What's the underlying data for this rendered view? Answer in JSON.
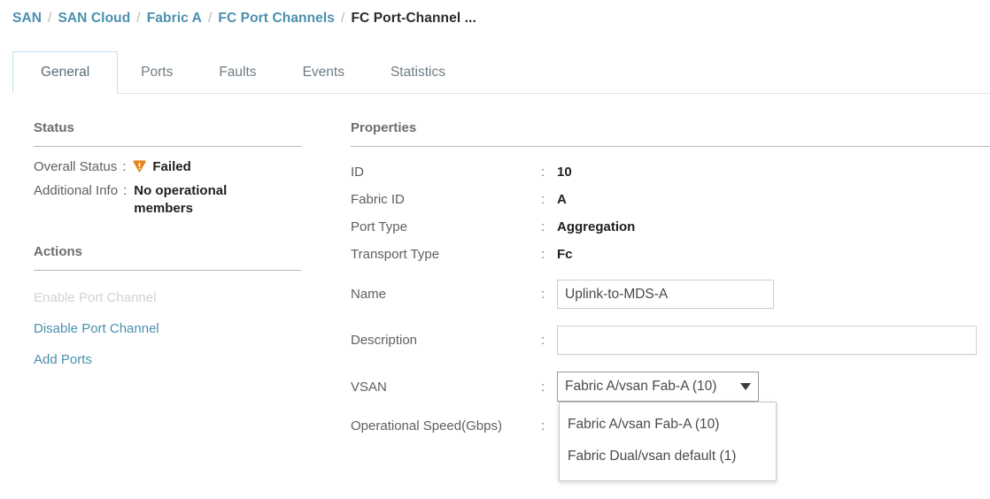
{
  "breadcrumb": {
    "separator": "/",
    "items": [
      {
        "label": "SAN",
        "current": false
      },
      {
        "label": "SAN Cloud",
        "current": false
      },
      {
        "label": "Fabric A",
        "current": false
      },
      {
        "label": "FC Port Channels",
        "current": false
      },
      {
        "label": "FC Port-Channel ...",
        "current": true
      }
    ]
  },
  "tabs": [
    {
      "label": "General",
      "active": true
    },
    {
      "label": "Ports",
      "active": false
    },
    {
      "label": "Faults",
      "active": false
    },
    {
      "label": "Events",
      "active": false
    },
    {
      "label": "Statistics",
      "active": false
    }
  ],
  "status": {
    "heading": "Status",
    "overall_status_label": "Overall Status",
    "overall_status_value": "Failed",
    "overall_status_icon": "warning-triangle-icon",
    "additional_info_label": "Additional Info",
    "additional_info_value": "No operational members",
    "colon": ":"
  },
  "actions": {
    "heading": "Actions",
    "items": [
      {
        "label": "Enable Port Channel",
        "disabled": true
      },
      {
        "label": "Disable Port Channel",
        "disabled": false
      },
      {
        "label": "Add Ports",
        "disabled": false
      }
    ]
  },
  "properties": {
    "heading": "Properties",
    "colon": ":",
    "rows": [
      {
        "label": "ID",
        "value": "10"
      },
      {
        "label": "Fabric ID",
        "value": "A"
      },
      {
        "label": "Port Type",
        "value": "Aggregation"
      },
      {
        "label": "Transport Type",
        "value": "Fc"
      }
    ],
    "name_label": "Name",
    "name_value": "Uplink-to-MDS-A",
    "name_placeholder": "",
    "description_label": "Description",
    "description_value": "",
    "description_placeholder": "",
    "vsan_label": "VSAN",
    "vsan_selected": "Fabric A/vsan Fab-A (10)",
    "vsan_options": [
      "Fabric A/vsan Fab-A (10)",
      "Fabric Dual/vsan default (1)"
    ],
    "operational_speed_label": "Operational Speed(Gbps)"
  },
  "colors": {
    "link": "#4a90ad",
    "warning": "#e8831f",
    "tab_active_border": "#bfe0ec",
    "text": "#3d3d3d",
    "rule": "#b7b7b7"
  }
}
